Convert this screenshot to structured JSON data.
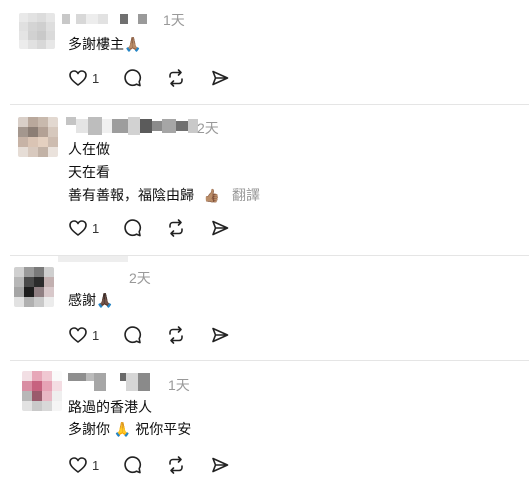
{
  "comments": [
    {
      "time": "1天",
      "lines": [
        "多謝樓主🙏🏽"
      ],
      "translate": "",
      "likes": "1"
    },
    {
      "time": "2天",
      "lines": [
        "人在做",
        "天在看",
        "善有善報，福陰由歸"
      ],
      "emoji_after_last": "👍🏽",
      "translate": "翻譯",
      "likes": "1"
    },
    {
      "time": "2天",
      "lines": [
        "感謝🙏🏿"
      ],
      "translate": "",
      "likes": "1"
    },
    {
      "time": "1天",
      "lines": [
        "路過的香港人",
        "多謝你 🙏 祝你平安"
      ],
      "translate": "",
      "likes": "1"
    }
  ],
  "icons": {
    "like": "heart-icon",
    "reply": "speech-bubble-icon",
    "repost": "repost-icon",
    "share": "send-icon"
  },
  "colors": {
    "text": "#101010",
    "muted": "#999999",
    "divider": "#e5e5e5"
  }
}
